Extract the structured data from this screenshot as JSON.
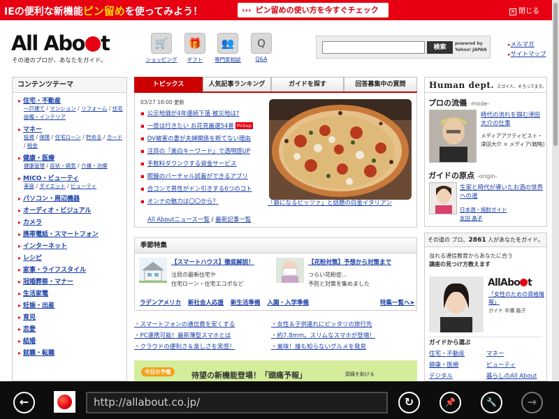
{
  "promo": {
    "text_pre": "IEの便利な新機能",
    "text_highlight": "ピン留め",
    "text_post": "を使ってみよう！",
    "button": "ピン留めの使い方を今すぐチェック",
    "button_arrows": "›››",
    "close": "閉じる"
  },
  "header": {
    "logo": "All Abo",
    "logo_tail": "t",
    "tagline": "その道のプロが、あなたをガイド。",
    "icons": [
      {
        "label": "ショッピング",
        "icon": "cart-icon"
      },
      {
        "label": "ギフト",
        "icon": "gift-icon"
      },
      {
        "label": "専門家相談",
        "icon": "people-icon"
      },
      {
        "label": "Q&A",
        "icon": "qa-icon"
      }
    ],
    "search": {
      "value": "",
      "button": "検索",
      "powered_1": "powered by",
      "powered_2": "Yahoo! JAPAN"
    },
    "links": [
      "メルマガ",
      "サイトマップ"
    ]
  },
  "sidebar": {
    "title": "コンテンツテーマ",
    "categories": [
      {
        "name": "住宅・不動産",
        "subs": [
          "一戸建て",
          "マンション",
          "リフォーム",
          "住宅設備・インテリア"
        ]
      },
      {
        "name": "マネー",
        "subs": [
          "投資",
          "保険",
          "住宅ローン",
          "貯める",
          "カード",
          "税金"
        ]
      },
      {
        "name": "健康・医療",
        "subs": [
          "健康管理",
          "症状・病気",
          "介護・治療"
        ]
      },
      {
        "name": "MICO・ビューティ",
        "subs": [
          "美容",
          "ダイエット",
          "ビューティ"
        ]
      },
      {
        "name": "パソコン・周辺機器",
        "subs": []
      },
      {
        "name": "オーディオ・ビジュアル",
        "subs": []
      },
      {
        "name": "カメラ",
        "subs": []
      },
      {
        "name": "携帯電話・スマートフォン",
        "subs": []
      },
      {
        "name": "インターネット",
        "subs": []
      },
      {
        "name": "レシピ",
        "subs": []
      },
      {
        "name": "家事・ライフスタイル",
        "subs": []
      },
      {
        "name": "冠婚葬祭・マナー",
        "subs": []
      },
      {
        "name": "生活家電",
        "subs": []
      },
      {
        "name": "妊娠・出産",
        "subs": []
      },
      {
        "name": "育児",
        "subs": []
      },
      {
        "name": "恋愛",
        "subs": []
      },
      {
        "name": "結婚",
        "subs": []
      },
      {
        "name": "就職・転職",
        "subs": []
      }
    ]
  },
  "tabs": [
    "トピックス",
    "人気記事ランキング",
    "ガイドを探す",
    "回答募集中の質問"
  ],
  "topics": {
    "date": "03/27 18:00 更新",
    "items": [
      {
        "text": "公示地価が4年連続下落 被災地は?",
        "pickup": ""
      },
      {
        "text": "一度は行きたい お花見厳選54景",
        "pickup": "Pickup"
      },
      {
        "text": "DV被害の妻が夫婦関係を断てない理由",
        "pickup": ""
      },
      {
        "text": "注目の「美白キーワード」で透明感UP",
        "pickup": ""
      },
      {
        "text": "手数料ダウンクする資金サービス",
        "pickup": ""
      },
      {
        "text": "眼鏡のバーチャル試着ができるアプリ",
        "pickup": ""
      },
      {
        "text": "合コンで男性がドン引きする6つのコト",
        "pickup": ""
      },
      {
        "text": "オンナの魅力は〇〇から？",
        "pickup": ""
      }
    ],
    "more_1": "All Aboutニュース一覧",
    "more_sep": " / ",
    "more_2": "最新記事一覧",
    "caption": "「癖になるピッツァ」と話題の白金イタリアン"
  },
  "season": {
    "title": "季節特集",
    "items": [
      {
        "title": "【スマートハウス】徹底解説！",
        "desc1": "注目の最新住宅や",
        "desc2": "住宅ローン・住宅エコポなど"
      },
      {
        "title": "【花粉対策】予想から対策まで",
        "desc1": "つらい花粉症…",
        "desc2": "予防と対策を集めました"
      }
    ],
    "links": [
      "ラデンアメリカ",
      "新社会人応援",
      "新生活準備",
      "入園・入学準備"
    ],
    "all": "特集一覧へ"
  },
  "bottom_links": [
    "スマートフォンの通信費を安くする",
    "女性＆子供連れにピッタリの旅行先",
    "PC連携可能！最新薄型スマホとは",
    "約7.8mm。スリムなスマホが登場！",
    "クラウドの便利さ＆楽しさを実感！",
    "美味！誰も知らないグルメを発見"
  ],
  "banner": {
    "tag": "今日の予報",
    "text": "待望の新機能登場！「頭痛予報」",
    "side": "頭痛を助ける"
  },
  "human": {
    "title": "Human dept.",
    "subtitle": "スゴイ人、そろってます。",
    "sec1": "プロの流儀",
    "sec1_sub": "-mode-",
    "article1": "時代の流れを掴む津田大介の仕事",
    "meta1a": "メディアアクティビスト・",
    "meta1b": "津田大介 × メディア(戦略)",
    "sec2": "ガイドの原点",
    "sec2_sub": "-origin-",
    "article2": "生家と時代が導いたお酒の世界への道",
    "meta2a": "日本酒・焼酎ガイド",
    "meta2b": "友田 晶子"
  },
  "guides": {
    "count_pre": "その道の プロ、",
    "count": "2861",
    "count_post": " 人があなたをガイド。",
    "text1": "溢れる通信教育からあなたに合う",
    "text2": "講座の見つけ方教えます",
    "logo": "AllAbo",
    "logo_tail": "t",
    "article": "「女性のための資格情報」",
    "name": "ガイド 中瀬 路子",
    "from": "ガイドから選ぶ",
    "links": [
      "住宅・不動産",
      "マネー",
      "健康・医療",
      "ビューティ",
      "デジタル",
      "暮らしのAll About"
    ]
  },
  "appbar": {
    "url": "http://allabout.co.jp/",
    "back": "←",
    "refresh": "↻",
    "pin": "📌",
    "tools": "🔧",
    "forward": "→"
  }
}
